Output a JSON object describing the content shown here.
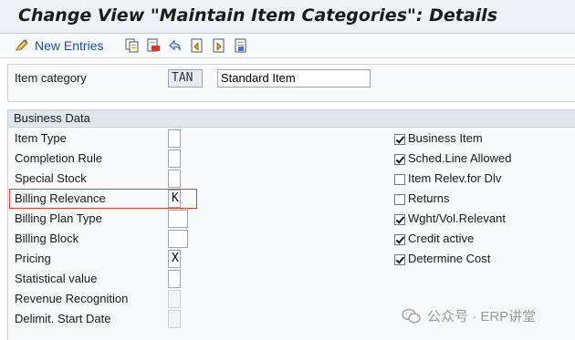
{
  "window": {
    "title": "Change View \"Maintain Item Categories\": Details"
  },
  "toolbar": {
    "new_entries_label": "New Entries",
    "icons": [
      "edit-pencil-icon",
      "copy-icon",
      "delete-icon",
      "undo-icon",
      "prev-entry-icon",
      "next-entry-icon",
      "select-icon"
    ]
  },
  "header": {
    "item_category_label": "Item category",
    "item_category_value": "TAN",
    "item_category_desc": "Standard Item"
  },
  "business_data": {
    "title": "Business Data",
    "fields": [
      {
        "label": "Item Type",
        "value": ""
      },
      {
        "label": "Completion Rule",
        "value": ""
      },
      {
        "label": "Special Stock",
        "value": ""
      },
      {
        "label": "Billing Relevance",
        "value": "K"
      },
      {
        "label": "Billing Plan Type",
        "value": ""
      },
      {
        "label": "Billing Block",
        "value": ""
      },
      {
        "label": "Pricing",
        "value": "X"
      },
      {
        "label": "Statistical value",
        "value": ""
      },
      {
        "label": "Revenue Recognition",
        "value": ""
      },
      {
        "label": "Delimit. Start Date",
        "value": ""
      }
    ],
    "checkboxes": [
      {
        "label": "Business Item",
        "checked": true
      },
      {
        "label": "Sched.Line Allowed",
        "checked": true
      },
      {
        "label": "Item Relev.for Dlv",
        "checked": false
      },
      {
        "label": "Returns",
        "checked": false
      },
      {
        "label": "Wght/Vol.Relevant",
        "checked": true
      },
      {
        "label": "Credit active",
        "checked": true
      },
      {
        "label": "Determine Cost",
        "checked": true
      }
    ]
  },
  "watermark": {
    "text": "公众号 · ERP讲堂"
  },
  "colors": {
    "highlight_border": "#e0393e",
    "title_bar": "#eef2f7",
    "group_header": "#dfe6ee",
    "link_blue": "#1b4f9c"
  }
}
